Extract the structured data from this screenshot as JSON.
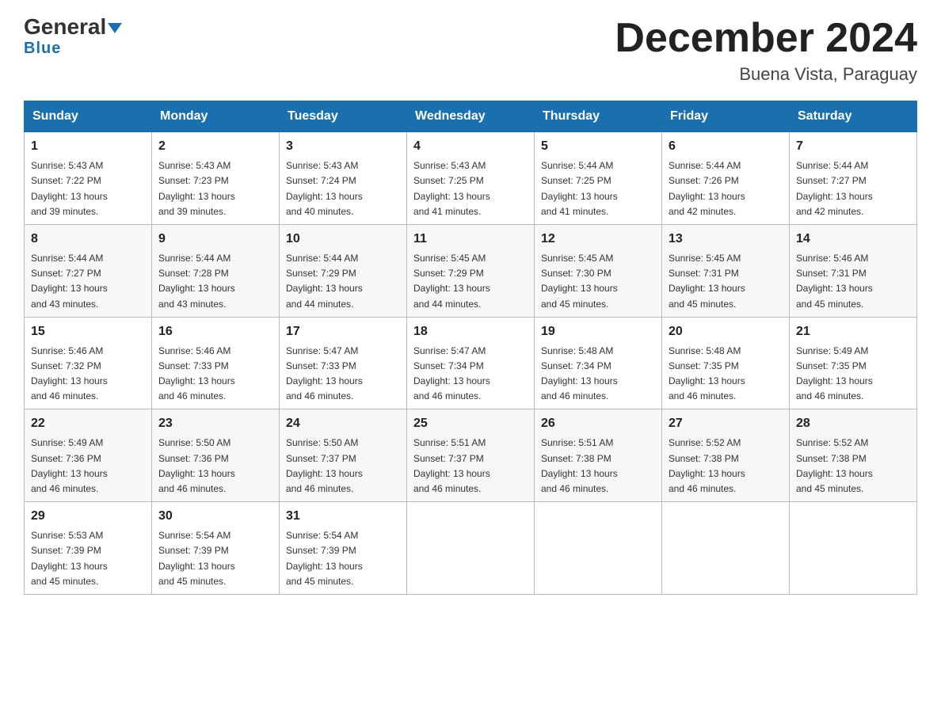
{
  "header": {
    "logo_general": "General",
    "logo_blue": "Blue",
    "month_title": "December 2024",
    "location": "Buena Vista, Paraguay"
  },
  "weekdays": [
    "Sunday",
    "Monday",
    "Tuesday",
    "Wednesday",
    "Thursday",
    "Friday",
    "Saturday"
  ],
  "weeks": [
    [
      {
        "day": "1",
        "sunrise": "5:43 AM",
        "sunset": "7:22 PM",
        "daylight": "13 hours and 39 minutes."
      },
      {
        "day": "2",
        "sunrise": "5:43 AM",
        "sunset": "7:23 PM",
        "daylight": "13 hours and 39 minutes."
      },
      {
        "day": "3",
        "sunrise": "5:43 AM",
        "sunset": "7:24 PM",
        "daylight": "13 hours and 40 minutes."
      },
      {
        "day": "4",
        "sunrise": "5:43 AM",
        "sunset": "7:25 PM",
        "daylight": "13 hours and 41 minutes."
      },
      {
        "day": "5",
        "sunrise": "5:44 AM",
        "sunset": "7:25 PM",
        "daylight": "13 hours and 41 minutes."
      },
      {
        "day": "6",
        "sunrise": "5:44 AM",
        "sunset": "7:26 PM",
        "daylight": "13 hours and 42 minutes."
      },
      {
        "day": "7",
        "sunrise": "5:44 AM",
        "sunset": "7:27 PM",
        "daylight": "13 hours and 42 minutes."
      }
    ],
    [
      {
        "day": "8",
        "sunrise": "5:44 AM",
        "sunset": "7:27 PM",
        "daylight": "13 hours and 43 minutes."
      },
      {
        "day": "9",
        "sunrise": "5:44 AM",
        "sunset": "7:28 PM",
        "daylight": "13 hours and 43 minutes."
      },
      {
        "day": "10",
        "sunrise": "5:44 AM",
        "sunset": "7:29 PM",
        "daylight": "13 hours and 44 minutes."
      },
      {
        "day": "11",
        "sunrise": "5:45 AM",
        "sunset": "7:29 PM",
        "daylight": "13 hours and 44 minutes."
      },
      {
        "day": "12",
        "sunrise": "5:45 AM",
        "sunset": "7:30 PM",
        "daylight": "13 hours and 45 minutes."
      },
      {
        "day": "13",
        "sunrise": "5:45 AM",
        "sunset": "7:31 PM",
        "daylight": "13 hours and 45 minutes."
      },
      {
        "day": "14",
        "sunrise": "5:46 AM",
        "sunset": "7:31 PM",
        "daylight": "13 hours and 45 minutes."
      }
    ],
    [
      {
        "day": "15",
        "sunrise": "5:46 AM",
        "sunset": "7:32 PM",
        "daylight": "13 hours and 46 minutes."
      },
      {
        "day": "16",
        "sunrise": "5:46 AM",
        "sunset": "7:33 PM",
        "daylight": "13 hours and 46 minutes."
      },
      {
        "day": "17",
        "sunrise": "5:47 AM",
        "sunset": "7:33 PM",
        "daylight": "13 hours and 46 minutes."
      },
      {
        "day": "18",
        "sunrise": "5:47 AM",
        "sunset": "7:34 PM",
        "daylight": "13 hours and 46 minutes."
      },
      {
        "day": "19",
        "sunrise": "5:48 AM",
        "sunset": "7:34 PM",
        "daylight": "13 hours and 46 minutes."
      },
      {
        "day": "20",
        "sunrise": "5:48 AM",
        "sunset": "7:35 PM",
        "daylight": "13 hours and 46 minutes."
      },
      {
        "day": "21",
        "sunrise": "5:49 AM",
        "sunset": "7:35 PM",
        "daylight": "13 hours and 46 minutes."
      }
    ],
    [
      {
        "day": "22",
        "sunrise": "5:49 AM",
        "sunset": "7:36 PM",
        "daylight": "13 hours and 46 minutes."
      },
      {
        "day": "23",
        "sunrise": "5:50 AM",
        "sunset": "7:36 PM",
        "daylight": "13 hours and 46 minutes."
      },
      {
        "day": "24",
        "sunrise": "5:50 AM",
        "sunset": "7:37 PM",
        "daylight": "13 hours and 46 minutes."
      },
      {
        "day": "25",
        "sunrise": "5:51 AM",
        "sunset": "7:37 PM",
        "daylight": "13 hours and 46 minutes."
      },
      {
        "day": "26",
        "sunrise": "5:51 AM",
        "sunset": "7:38 PM",
        "daylight": "13 hours and 46 minutes."
      },
      {
        "day": "27",
        "sunrise": "5:52 AM",
        "sunset": "7:38 PM",
        "daylight": "13 hours and 46 minutes."
      },
      {
        "day": "28",
        "sunrise": "5:52 AM",
        "sunset": "7:38 PM",
        "daylight": "13 hours and 45 minutes."
      }
    ],
    [
      {
        "day": "29",
        "sunrise": "5:53 AM",
        "sunset": "7:39 PM",
        "daylight": "13 hours and 45 minutes."
      },
      {
        "day": "30",
        "sunrise": "5:54 AM",
        "sunset": "7:39 PM",
        "daylight": "13 hours and 45 minutes."
      },
      {
        "day": "31",
        "sunrise": "5:54 AM",
        "sunset": "7:39 PM",
        "daylight": "13 hours and 45 minutes."
      },
      null,
      null,
      null,
      null
    ]
  ],
  "labels": {
    "sunrise": "Sunrise:",
    "sunset": "Sunset:",
    "daylight": "Daylight:"
  }
}
